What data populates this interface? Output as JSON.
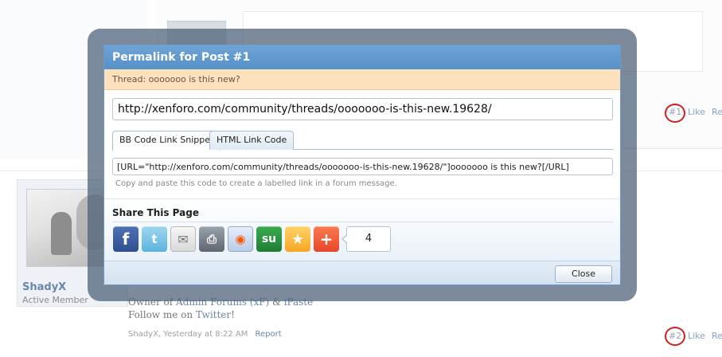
{
  "background": {
    "user": {
      "name": "ShadyX",
      "title": "Active Member"
    },
    "signature": {
      "line1_prefix": "Owner of",
      "line1_link1": "Admin Forums (xF)",
      "line1_amp": "&",
      "line1_link2": "iPaste",
      "line2_prefix": "Follow me on",
      "line2_link": "Twitter",
      "line2_suffix": "!"
    },
    "meta": {
      "byline": "ShadyX, Yesterday at 8:22 AM",
      "report": "Report"
    },
    "post1": {
      "number": "#1",
      "like": "Like",
      "reply": "Re"
    },
    "post2": {
      "number": "#2",
      "like": "Like",
      "reply": "Re"
    }
  },
  "dialog": {
    "title": "Permalink for Post #1",
    "thread": "Thread: ooooooo is this new?",
    "url": "http://xenforo.com/community/threads/ooooooo-is-this-new.19628/",
    "tabs": [
      {
        "label": "BB Code Link Snippet",
        "active": true
      },
      {
        "label": "HTML Link Code",
        "active": false
      }
    ],
    "code": "[URL=\"http://xenforo.com/community/threads/ooooooo-is-this-new.19628/\"]ooooooo is this new?[/URL]",
    "hint": "Copy and paste this code to create a labelled link in a forum message.",
    "share": {
      "title": "Share This Page",
      "buttons": [
        {
          "icon": "facebook-icon",
          "glyph": "f"
        },
        {
          "icon": "twitter-icon",
          "glyph": "t"
        },
        {
          "icon": "email-icon",
          "glyph": "✉"
        },
        {
          "icon": "print-icon",
          "glyph": "⎙"
        },
        {
          "icon": "reddit-icon",
          "glyph": "◉"
        },
        {
          "icon": "stumbleupon-icon",
          "glyph": "su"
        },
        {
          "icon": "favorite-star-icon",
          "glyph": "★"
        },
        {
          "icon": "add-plus-icon",
          "glyph": "+"
        }
      ],
      "count": "4"
    },
    "close_label": "Close"
  },
  "colors": {
    "title_bar": "#5791c8",
    "thread_bar": "#fde1bc",
    "annotation_circle": "#d21f1f"
  }
}
